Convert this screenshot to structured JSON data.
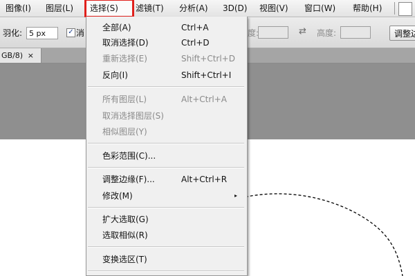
{
  "menubar": {
    "items": [
      "图像(I)",
      "图层(L)",
      "选择(S)",
      "滤镜(T)",
      "分析(A)",
      "3D(D)",
      "视图(V)",
      "窗口(W)",
      "帮助(H)"
    ],
    "active": "选择(S)",
    "highlight_color": "#e0201c"
  },
  "options": {
    "feather_label": "羽化:",
    "feather_value": "5 px",
    "antialias_label": "消",
    "antialias_checked": true,
    "width_label": "度:",
    "height_label": "高度:",
    "refine_button": "调整边"
  },
  "document_tab": {
    "label": "GB/8)",
    "close": "×"
  },
  "select_menu": {
    "items": [
      {
        "label": "全部(A)",
        "shortcut": "Ctrl+A",
        "enabled": true
      },
      {
        "label": "取消选择(D)",
        "shortcut": "Ctrl+D",
        "enabled": true
      },
      {
        "label": "重新选择(E)",
        "shortcut": "Shift+Ctrl+D",
        "enabled": false
      },
      {
        "label": "反向(I)",
        "shortcut": "Shift+Ctrl+I",
        "enabled": true
      },
      {
        "label": "所有图层(L)",
        "shortcut": "Alt+Ctrl+A",
        "enabled": false
      },
      {
        "label": "取消选择图层(S)",
        "shortcut": "",
        "enabled": false
      },
      {
        "label": "相似图层(Y)",
        "shortcut": "",
        "enabled": false
      },
      {
        "label": "色彩范围(C)...",
        "shortcut": "",
        "enabled": true
      },
      {
        "label": "调整边缘(F)...",
        "shortcut": "Alt+Ctrl+R",
        "enabled": true
      },
      {
        "label": "修改(M)",
        "shortcut": "",
        "enabled": true,
        "submenu": true
      },
      {
        "label": "扩大选取(G)",
        "shortcut": "",
        "enabled": true
      },
      {
        "label": "选取相似(R)",
        "shortcut": "",
        "enabled": true
      },
      {
        "label": "变换选区(T)",
        "shortcut": "",
        "enabled": true
      }
    ]
  },
  "icons": {
    "submenu_arrow": "▸",
    "swap_arrow": "⇄",
    "check": "✓"
  }
}
